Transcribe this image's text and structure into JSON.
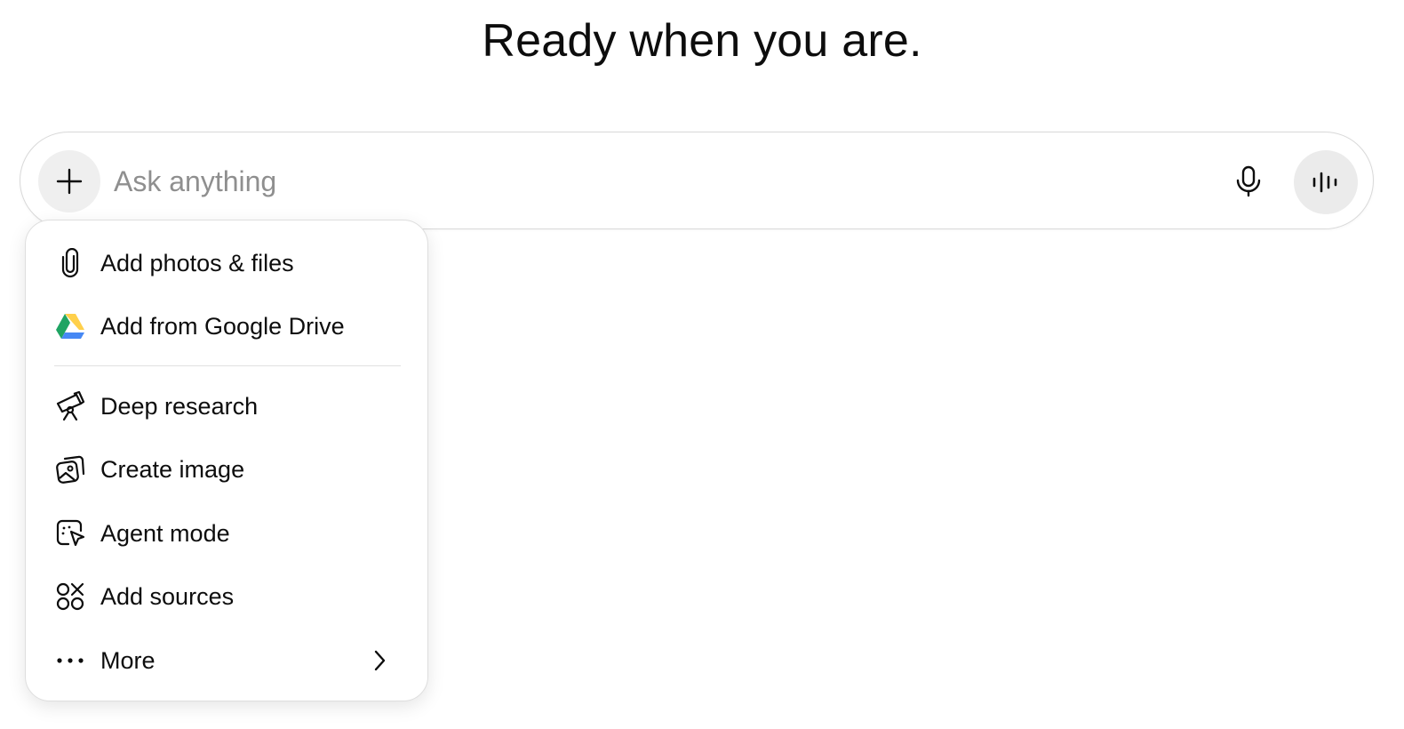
{
  "heading": "Ready when you are.",
  "composer": {
    "placeholder": "Ask anything",
    "plus_icon": "plus-icon",
    "mic_icon": "microphone-icon",
    "voice_icon": "voice-waveform-icon"
  },
  "menu": {
    "items": [
      {
        "label": "Add photos & files",
        "icon": "paperclip-icon"
      },
      {
        "label": "Add from Google Drive",
        "icon": "google-drive-icon"
      },
      {
        "label": "Deep research",
        "icon": "telescope-icon"
      },
      {
        "label": "Create image",
        "icon": "image-icon"
      },
      {
        "label": "Agent mode",
        "icon": "cursor-click-icon"
      },
      {
        "label": "Add sources",
        "icon": "sources-icon"
      },
      {
        "label": "More",
        "icon": "more-dots-icon",
        "chevron": "chevron-right-icon"
      }
    ]
  },
  "colors": {
    "drive_green": "#1fa463",
    "drive_yellow": "#ffd04b",
    "drive_blue": "#4688f4",
    "button_bg": "#efefef"
  }
}
